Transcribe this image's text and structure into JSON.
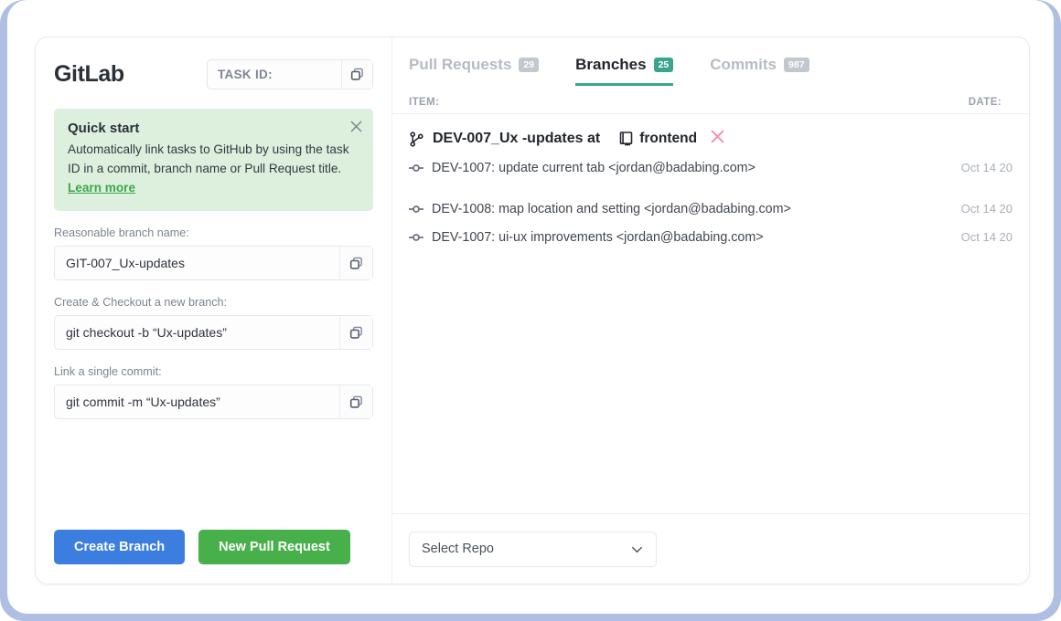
{
  "app": {
    "brand": "GitLab"
  },
  "task_id_field": {
    "label": "TASK ID:",
    "value": "",
    "copy_icon": "copy-icon"
  },
  "quick_start": {
    "title": "Quick start",
    "body_prefix": "Automatically link tasks to GitHub by using the task ID in a commit, branch name or Pull Request title. ",
    "link_label": "Learn more",
    "close_icon": "close-icon",
    "bg_color": "#ddf0dd",
    "link_color": "#3aa84a"
  },
  "fields": [
    {
      "label": "Reasonable branch name:",
      "value": "GIT-007_Ux-updates",
      "placeholder": "Reasonable branch name",
      "copy_icon": "copy-icon"
    },
    {
      "label": "Create & Checkout a new branch:",
      "value": "git checkout -b “Ux-updates”",
      "placeholder": "git checkout -b",
      "copy_icon": "copy-icon"
    },
    {
      "label": "Link a single commit:",
      "value": "git commit -m “Ux-updates”",
      "placeholder": "git commit -m",
      "copy_icon": "copy-icon"
    }
  ],
  "actions": {
    "create_branch": "Create Branch",
    "new_pull_request": "New Pull Request",
    "create_branch_color": "#3b7ee0",
    "new_pull_request_color": "#47b04b"
  },
  "tabs": [
    {
      "label": "Pull Requests",
      "badge": "29",
      "active": false
    },
    {
      "label": "Branches",
      "badge": "25",
      "active": true
    },
    {
      "label": "Commits",
      "badge": "987",
      "active": false
    }
  ],
  "columns": {
    "item": "ITEM:",
    "date": "DATE:"
  },
  "branch": {
    "branch_icon": "git-branch-icon",
    "name": "DEV-007_Ux -updates at",
    "repo_icon": "repo-book-icon",
    "repo": "frontend",
    "remove_icon": "close-icon",
    "remove_color": "#f48fb1"
  },
  "commits": [
    {
      "icon": "git-commit-icon",
      "text": "DEV-1007: update current tab <jordan@badabing.com>",
      "date": "Oct 14 20"
    },
    {
      "icon": "git-commit-icon",
      "text": "DEV-1008: map location and setting <jordan@badabing.com>",
      "date": "Oct 14 20"
    },
    {
      "icon": "git-commit-icon",
      "text": "DEV-1007: ui-ux improvements <jordan@badabing.com>",
      "date": "Oct 14 20"
    }
  ],
  "repo_select": {
    "value": "Select Repo",
    "chevron_icon": "chevron-down-icon"
  }
}
